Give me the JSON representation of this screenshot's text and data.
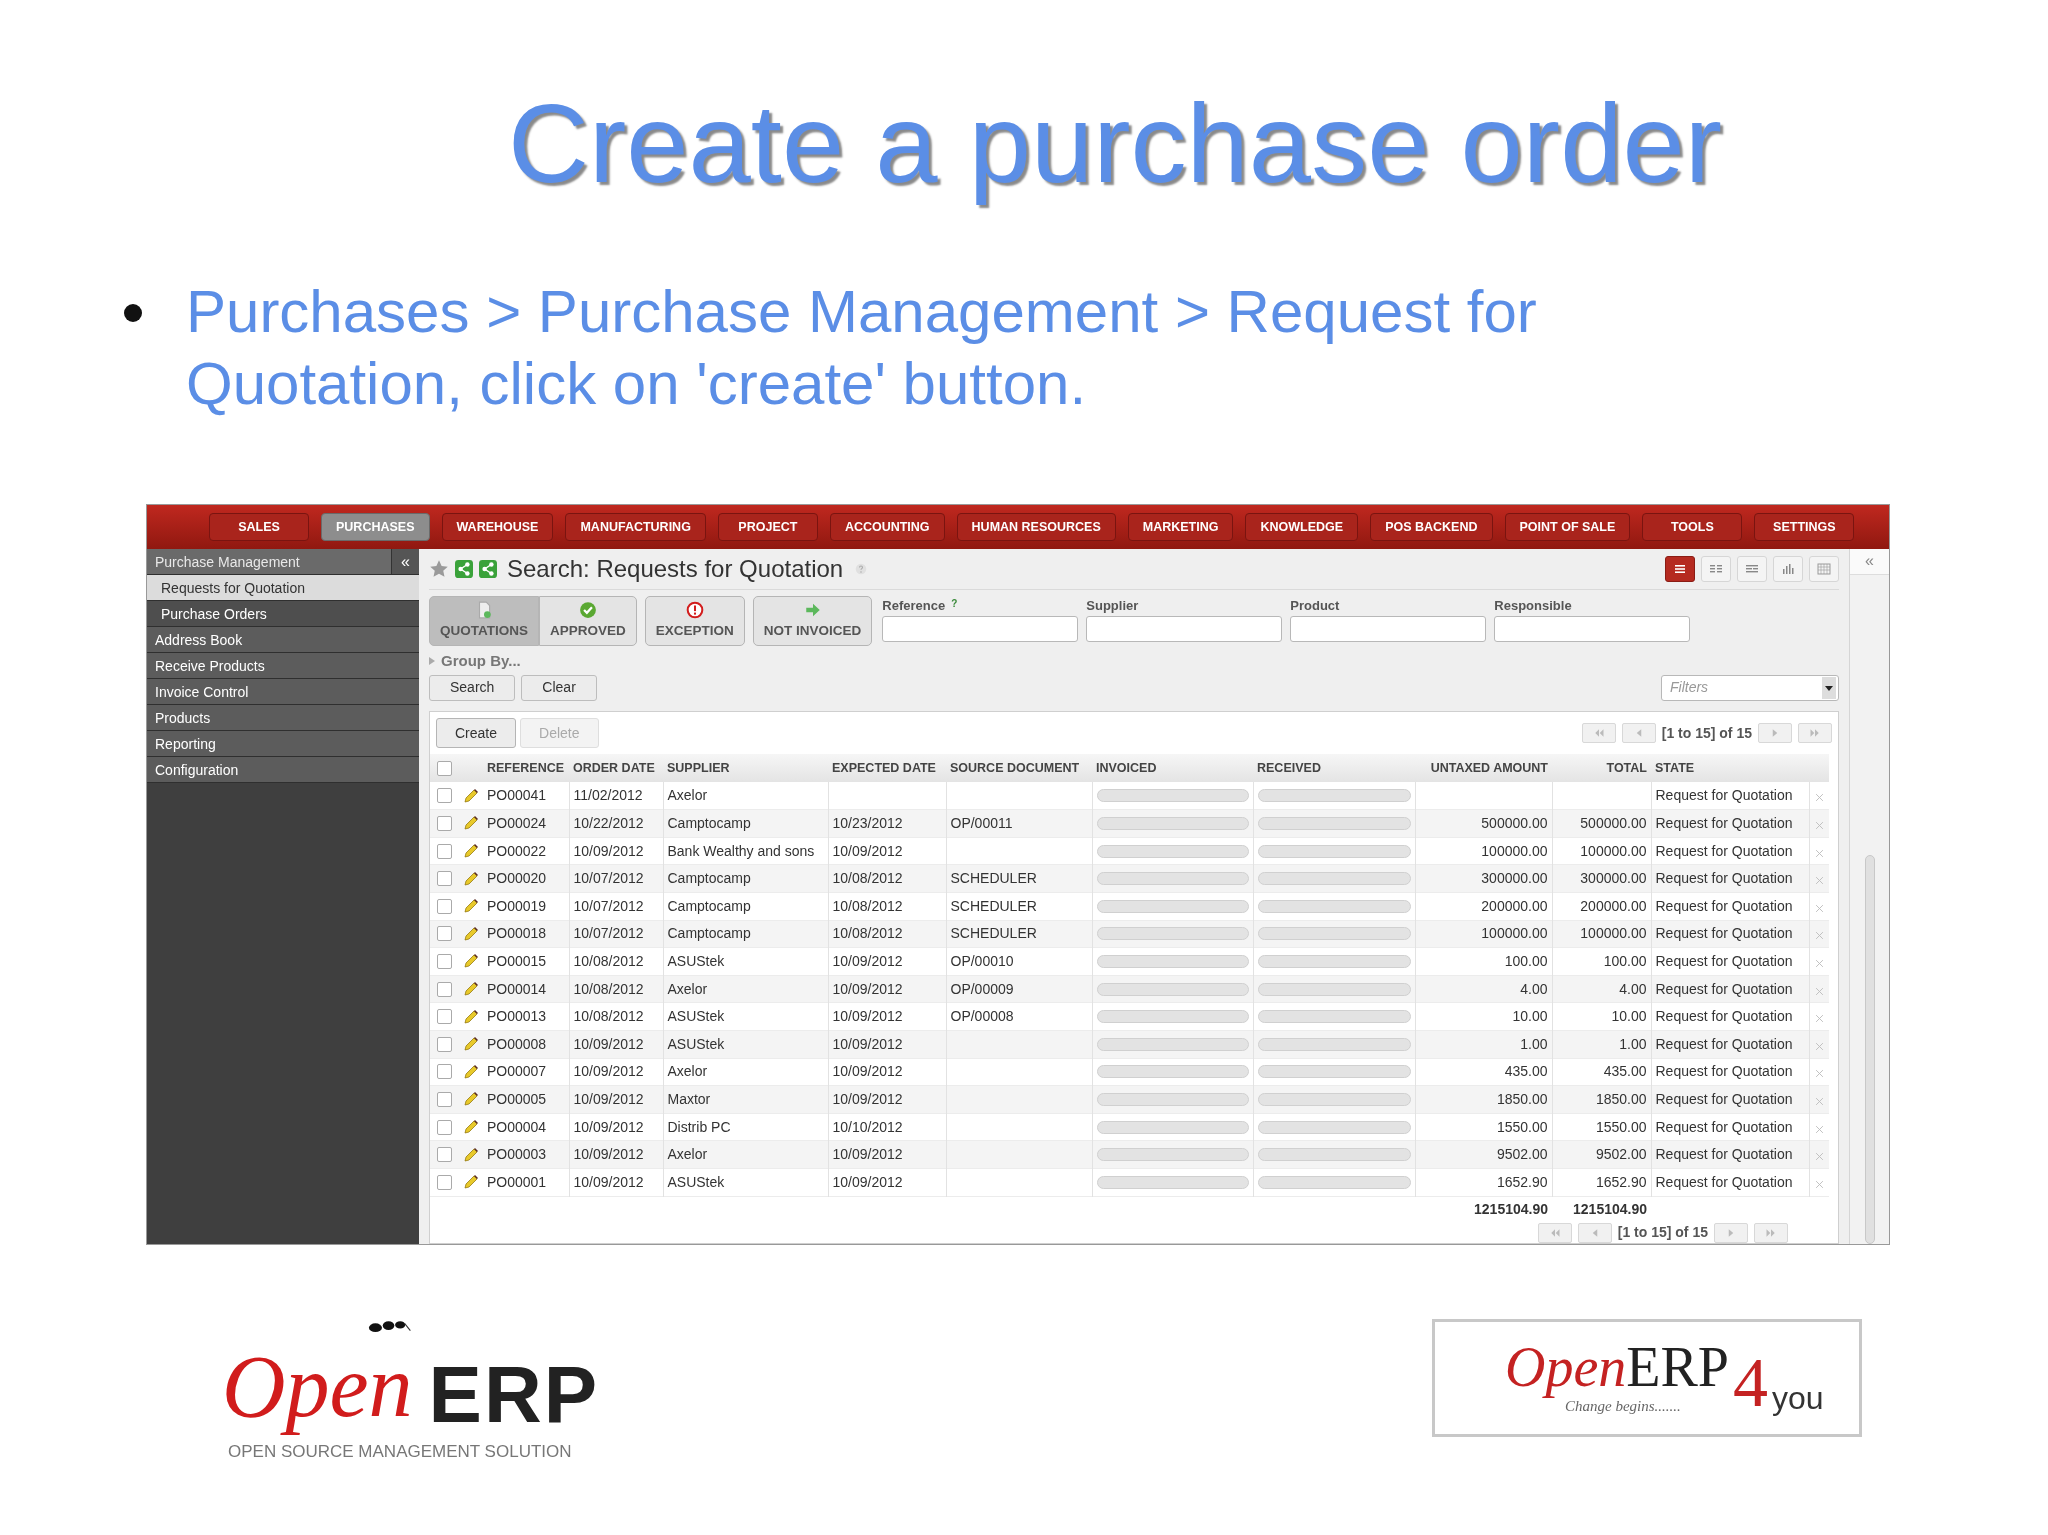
{
  "slide": {
    "title": "Create a purchase order",
    "bullets": [
      "Purchases > Purchase Management > Request for Quotation, click on 'create' button."
    ]
  },
  "app": {
    "menu": [
      {
        "label": "SALES",
        "selected": false
      },
      {
        "label": "PURCHASES",
        "selected": true
      },
      {
        "label": "WAREHOUSE",
        "selected": false
      },
      {
        "label": "MANUFACTURING",
        "selected": false
      },
      {
        "label": "PROJECT",
        "selected": false
      },
      {
        "label": "ACCOUNTING",
        "selected": false
      },
      {
        "label": "HUMAN RESOURCES",
        "selected": false
      },
      {
        "label": "MARKETING",
        "selected": false
      },
      {
        "label": "KNOWLEDGE",
        "selected": false
      },
      {
        "label": "POS BACKEND",
        "selected": false
      },
      {
        "label": "POINT OF SALE",
        "selected": false
      },
      {
        "label": "TOOLS",
        "selected": false
      },
      {
        "label": "SETTINGS",
        "selected": false
      }
    ],
    "sidebar": {
      "collapse_glyph": "«",
      "items": [
        {
          "label": "Purchase Management",
          "kind": "header",
          "selected": false
        },
        {
          "label": "Requests for Quotation",
          "kind": "sub",
          "selected": true
        },
        {
          "label": "Purchase Orders",
          "kind": "sub",
          "selected": false
        },
        {
          "label": "Address Book",
          "kind": "item",
          "selected": false
        },
        {
          "label": "Receive Products",
          "kind": "item",
          "selected": false
        },
        {
          "label": "Invoice Control",
          "kind": "item",
          "selected": false
        },
        {
          "label": "Products",
          "kind": "item",
          "selected": false
        },
        {
          "label": "Reporting",
          "kind": "item",
          "selected": false
        },
        {
          "label": "Configuration",
          "kind": "item",
          "selected": false
        }
      ]
    },
    "right_panel": {
      "toggle_glyph": "«"
    },
    "page_title": "Search: Requests for Quotation",
    "view_modes": [
      {
        "selected": true
      },
      {
        "selected": false
      },
      {
        "selected": false
      },
      {
        "selected": false
      },
      {
        "selected": false
      }
    ],
    "filter_buttons": [
      {
        "label": "QUOTATIONS",
        "selected": true
      },
      {
        "label": "APPROVED",
        "selected": false
      },
      {
        "label": "EXCEPTION",
        "selected": false
      },
      {
        "label": "NOT INVOICED",
        "selected": false
      }
    ],
    "search_fields": [
      {
        "label": "Reference",
        "help": "?"
      },
      {
        "label": "Supplier"
      },
      {
        "label": "Product"
      },
      {
        "label": "Responsible"
      }
    ],
    "group_by": "Group By...",
    "search_buttons": [
      "Search",
      "Clear"
    ],
    "filters": {
      "placeholder": "Filters"
    },
    "list_buttons": [
      {
        "label": "Create",
        "disabled": false
      },
      {
        "label": "Delete",
        "disabled": true
      }
    ],
    "pager_top": "[1 to 15] of 15",
    "select_all": {
      "checked": false
    },
    "columns": [
      "REFERENCE",
      "ORDER DATE",
      "SUPPLIER",
      "EXPECTED DATE",
      "SOURCE DOCUMENT",
      "INVOICED",
      "RECEIVED",
      "UNTAXED AMOUNT",
      "TOTAL",
      "STATE"
    ],
    "rows": [
      {
        "checked": false,
        "reference": "PO00041",
        "order_date": "11/02/2012",
        "supplier": "Axelor",
        "invoiced": {
          "level": 0
        },
        "received": {
          "level": 0
        },
        "state": "Request for Quotation"
      },
      {
        "checked": false,
        "reference": "PO00024",
        "order_date": "10/22/2012",
        "supplier": "Camptocamp",
        "expected_date": "10/23/2012",
        "source_document": "OP/00011",
        "invoiced": {
          "level": 0
        },
        "received": {
          "level": 0
        },
        "untaxed_amount": "500000.00",
        "total": "500000.00",
        "state": "Request for Quotation"
      },
      {
        "checked": false,
        "reference": "PO00022",
        "order_date": "10/09/2012",
        "supplier": "Bank Wealthy and sons",
        "expected_date": "10/09/2012",
        "invoiced": {
          "level": 0
        },
        "received": {
          "level": 0
        },
        "untaxed_amount": "100000.00",
        "total": "100000.00",
        "state": "Request for Quotation"
      },
      {
        "checked": false,
        "reference": "PO00020",
        "order_date": "10/07/2012",
        "supplier": "Camptocamp",
        "expected_date": "10/08/2012",
        "source_document": "SCHEDULER",
        "invoiced": {
          "level": 0
        },
        "received": {
          "level": 0
        },
        "untaxed_amount": "300000.00",
        "total": "300000.00",
        "state": "Request for Quotation"
      },
      {
        "checked": false,
        "reference": "PO00019",
        "order_date": "10/07/2012",
        "supplier": "Camptocamp",
        "expected_date": "10/08/2012",
        "source_document": "SCHEDULER",
        "invoiced": {
          "level": 0
        },
        "received": {
          "level": 0
        },
        "untaxed_amount": "200000.00",
        "total": "200000.00",
        "state": "Request for Quotation"
      },
      {
        "checked": false,
        "reference": "PO00018",
        "order_date": "10/07/2012",
        "supplier": "Camptocamp",
        "expected_date": "10/08/2012",
        "source_document": "SCHEDULER",
        "invoiced": {
          "level": 0
        },
        "received": {
          "level": 0
        },
        "untaxed_amount": "100000.00",
        "total": "100000.00",
        "state": "Request for Quotation"
      },
      {
        "checked": false,
        "reference": "PO00015",
        "order_date": "10/08/2012",
        "supplier": "ASUStek",
        "expected_date": "10/09/2012",
        "source_document": "OP/00010",
        "invoiced": {
          "level": 0
        },
        "received": {
          "level": 0
        },
        "untaxed_amount": "100.00",
        "total": "100.00",
        "state": "Request for Quotation"
      },
      {
        "checked": false,
        "reference": "PO00014",
        "order_date": "10/08/2012",
        "supplier": "Axelor",
        "expected_date": "10/09/2012",
        "source_document": "OP/00009",
        "invoiced": {
          "level": 0
        },
        "received": {
          "level": 0
        },
        "untaxed_amount": "4.00",
        "total": "4.00",
        "state": "Request for Quotation"
      },
      {
        "checked": false,
        "reference": "PO00013",
        "order_date": "10/08/2012",
        "supplier": "ASUStek",
        "expected_date": "10/09/2012",
        "source_document": "OP/00008",
        "invoiced": {
          "level": 0
        },
        "received": {
          "level": 0
        },
        "untaxed_amount": "10.00",
        "total": "10.00",
        "state": "Request for Quotation"
      },
      {
        "checked": false,
        "reference": "PO00008",
        "order_date": "10/09/2012",
        "supplier": "ASUStek",
        "expected_date": "10/09/2012",
        "invoiced": {
          "level": 0
        },
        "received": {
          "level": 0
        },
        "untaxed_amount": "1.00",
        "total": "1.00",
        "state": "Request for Quotation"
      },
      {
        "checked": false,
        "reference": "PO00007",
        "order_date": "10/09/2012",
        "supplier": "Axelor",
        "expected_date": "10/09/2012",
        "invoiced": {
          "level": 0
        },
        "received": {
          "level": 0
        },
        "untaxed_amount": "435.00",
        "total": "435.00",
        "state": "Request for Quotation"
      },
      {
        "checked": false,
        "reference": "PO00005",
        "order_date": "10/09/2012",
        "supplier": "Maxtor",
        "expected_date": "10/09/2012",
        "invoiced": {
          "level": 0
        },
        "received": {
          "level": 0
        },
        "untaxed_amount": "1850.00",
        "total": "1850.00",
        "state": "Request for Quotation"
      },
      {
        "checked": false,
        "reference": "PO00004",
        "order_date": "10/09/2012",
        "supplier": "Distrib PC",
        "expected_date": "10/10/2012",
        "invoiced": {
          "level": 0
        },
        "received": {
          "level": 0
        },
        "untaxed_amount": "1550.00",
        "total": "1550.00",
        "state": "Request for Quotation"
      },
      {
        "checked": false,
        "reference": "PO00003",
        "order_date": "10/09/2012",
        "supplier": "Axelor",
        "expected_date": "10/09/2012",
        "invoiced": {
          "level": 0
        },
        "received": {
          "level": 0
        },
        "untaxed_amount": "9502.00",
        "total": "9502.00",
        "state": "Request for Quotation"
      },
      {
        "checked": false,
        "reference": "PO00001",
        "order_date": "10/09/2012",
        "supplier": "ASUStek",
        "expected_date": "10/09/2012",
        "invoiced": {
          "level": 0
        },
        "received": {
          "level": 0
        },
        "untaxed_amount": "1652.90",
        "total": "1652.90",
        "state": "Request for Quotation"
      }
    ],
    "totals": {
      "untaxed_amount": "1215104.90",
      "total": "1215104.90"
    },
    "pager_bottom": "[1 to 15] of 15"
  },
  "logos": {
    "left": {
      "open": "Open",
      "erp": "ERP",
      "tagline": "OPEN SOURCE MANAGEMENT SOLUTION"
    },
    "right": {
      "open": "Open",
      "erp": "ERP",
      "tagline": "Change begins.......",
      "four": "4",
      "you": "you"
    }
  }
}
